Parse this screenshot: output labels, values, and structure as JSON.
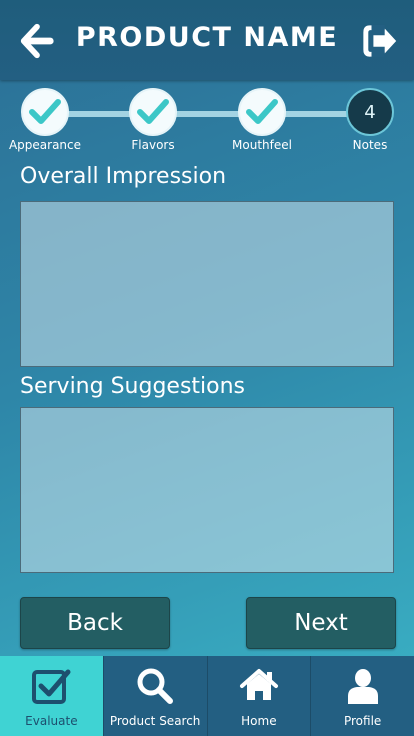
{
  "header": {
    "title": "PRODUCT NAME"
  },
  "stepper": {
    "steps": [
      {
        "label": "Appearance",
        "done": true
      },
      {
        "label": "Flavors",
        "done": true
      },
      {
        "label": "Mouthfeel",
        "done": true
      },
      {
        "label": "Notes",
        "number": "4",
        "current": true
      }
    ]
  },
  "form": {
    "overall_label": "Overall Impression",
    "serving_label": "Serving Suggestions",
    "overall_value": "",
    "serving_value": ""
  },
  "buttons": {
    "back": "Back",
    "next": "Next"
  },
  "nav": {
    "items": [
      {
        "label": "Evaluate",
        "icon": "checkbox-icon",
        "active": true
      },
      {
        "label": "Product Search",
        "icon": "search-icon"
      },
      {
        "label": "Home",
        "icon": "home-icon"
      },
      {
        "label": "Profile",
        "icon": "profile-icon"
      }
    ]
  },
  "colors": {
    "accent": "#3fd3d3",
    "header": "#235f82",
    "button": "#235e63",
    "check": "#3cc7c7"
  }
}
